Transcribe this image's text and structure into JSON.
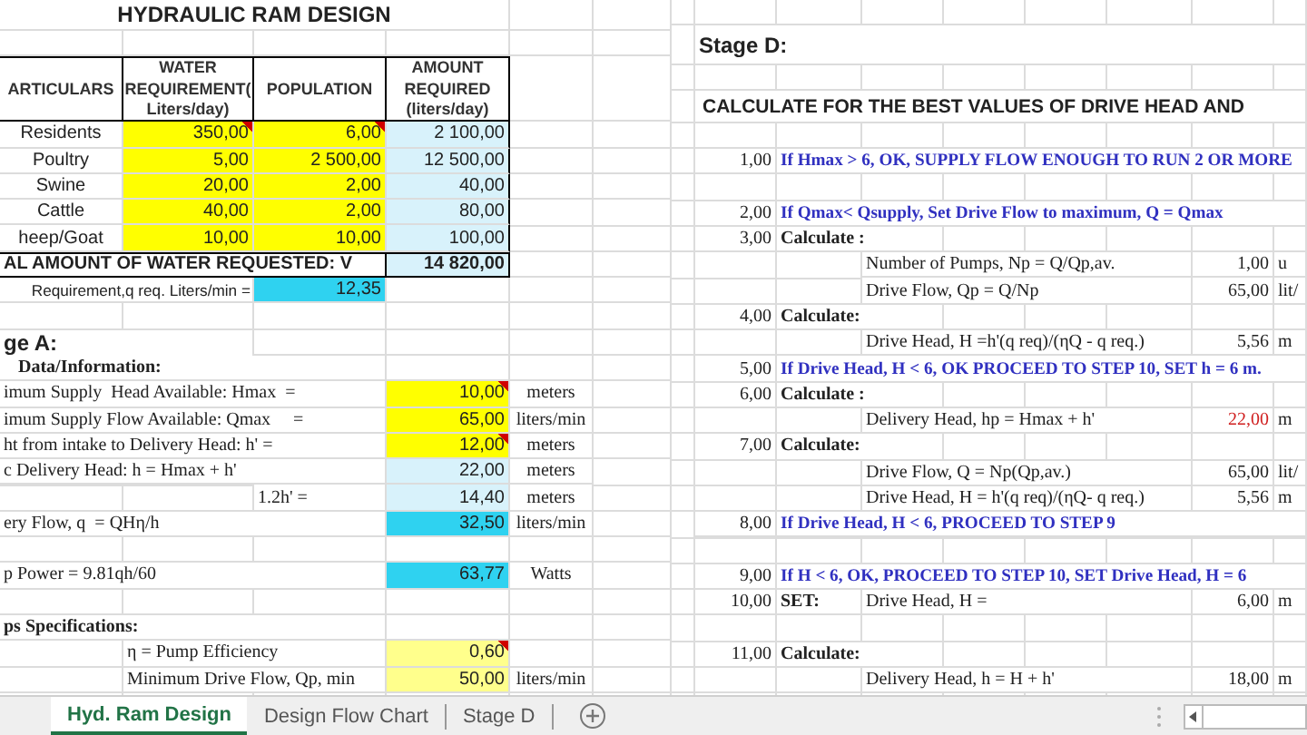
{
  "title": "HYDRAULIC RAM DESIGN",
  "demand_table": {
    "columns": [
      "ARTICULARS",
      "WATER REQUIREMENT( Liters/day)",
      "POPULATION",
      "AMOUNT REQUIRED (liters/day)"
    ],
    "rows": [
      {
        "particular": "Residents",
        "water_requirement": "350,00",
        "water_comment": true,
        "population": "6,00",
        "population_comment": true,
        "amount_required": "2 100,00"
      },
      {
        "particular": "Poultry",
        "water_requirement": "5,00",
        "water_comment": false,
        "population": "2 500,00",
        "population_comment": false,
        "amount_required": "12 500,00"
      },
      {
        "particular": "Swine",
        "water_requirement": "20,00",
        "water_comment": false,
        "population": "2,00",
        "population_comment": false,
        "amount_required": "40,00"
      },
      {
        "particular": "Cattle",
        "water_requirement": "40,00",
        "water_comment": false,
        "population": "2,00",
        "population_comment": false,
        "amount_required": "80,00"
      },
      {
        "particular": "heep/Goat",
        "water_requirement": "10,00",
        "water_comment": false,
        "population": "10,00",
        "population_comment": false,
        "amount_required": "100,00"
      }
    ],
    "total": {
      "label": "AL AMOUNT OF WATER REQUESTED: V",
      "value": "14 820,00"
    }
  },
  "requirement": {
    "label": "Requirement,q req. Liters/min =",
    "value": "12,35"
  },
  "stage_a": {
    "heading": "ge A:",
    "rows": [
      {
        "kind": "subheading",
        "label": "Data/Information:"
      },
      {
        "kind": "field",
        "label": "imum Supply  Head Available: Hmax  =",
        "value": "10,00",
        "unit": "meters",
        "color": "#ffff00",
        "comment": true
      },
      {
        "kind": "field",
        "label": "imum Supply Flow Available: Qmax     =",
        "value": "65,00",
        "unit": "liters/min",
        "color": "#ffff00",
        "comment": false
      },
      {
        "kind": "field",
        "label": "ht from intake to Delivery Head: h' =",
        "value": "12,00",
        "unit": "meters",
        "color": "#ffff00",
        "comment": true
      },
      {
        "kind": "field",
        "label": "c Delivery Head: h = Hmax + h'",
        "value": "22,00",
        "unit": "meters",
        "color": "#d8f2fb",
        "comment": false
      },
      {
        "kind": "aside",
        "label": "1.2h' =",
        "value": "14,40",
        "unit": "meters",
        "color": "#d8f2fb",
        "comment": false
      },
      {
        "kind": "field",
        "label": "ery Flow, q  = QHη/h",
        "value": "32,50",
        "unit": "liters/min",
        "color": "#2fd2f0",
        "comment": false
      },
      {
        "kind": "blank"
      },
      {
        "kind": "field",
        "label": "p Power = 9.81qh/60",
        "value": "63,77",
        "unit": "Watts",
        "color": "#2fd2f0",
        "comment": false
      },
      {
        "kind": "blank"
      },
      {
        "kind": "heading",
        "label": "ps Specifications:"
      },
      {
        "kind": "indented",
        "label": "η = Pump Efficiency",
        "value": "0,60",
        "color": "#ffff8c",
        "comment": true
      },
      {
        "kind": "indented",
        "label": "Minimum Drive Flow, Qp, min",
        "value": "50,00",
        "unit": "liters/min",
        "color": "#ffff8c",
        "comment": false
      }
    ]
  },
  "stage_d": {
    "heading": "Stage D:",
    "title": "CALCULATE FOR THE BEST VALUES OF DRIVE HEAD AND",
    "steps": [
      {
        "kind": "note",
        "step": "1,00",
        "text": "If Hmax > 6, OK, SUPPLY FLOW ENOUGH TO RUN 2 OR MORE"
      },
      {
        "kind": "blank"
      },
      {
        "kind": "note",
        "step": "2,00",
        "text": "If Qmax< Qsupply, Set Drive Flow to maximum, Q = Qmax"
      },
      {
        "kind": "action",
        "step": "3,00",
        "text": "Calculate :"
      },
      {
        "kind": "formula",
        "label": "Number of Pumps, Np = Q/Qp,av.",
        "value": "1,00",
        "unit": "u",
        "flagged": false
      },
      {
        "kind": "formula",
        "label": "Drive Flow, Qp = Q/Np",
        "value": "65,00",
        "unit": "lit/",
        "flagged": false
      },
      {
        "kind": "action",
        "step": "4,00",
        "text": "Calculate:"
      },
      {
        "kind": "formula",
        "label": "Drive Head, H =h'(q req)/(ηQ - q req.)",
        "value": "5,56",
        "unit": "m",
        "flagged": false
      },
      {
        "kind": "note",
        "step": "5,00",
        "text": "If Drive Head, H < 6, OK PROCEED TO STEP 10, SET h = 6 m."
      },
      {
        "kind": "action",
        "step": "6,00",
        "text": "Calculate :"
      },
      {
        "kind": "formula",
        "label": "Delivery Head, hp = Hmax + h'",
        "value": "22,00",
        "unit": "m",
        "flagged": true
      },
      {
        "kind": "action",
        "step": "7,00",
        "text": "Calculate:"
      },
      {
        "kind": "formula",
        "label": "Drive Flow, Q = Np(Qp,av.)",
        "value": "65,00",
        "unit": "lit/",
        "flagged": false
      },
      {
        "kind": "formula",
        "label": "Drive Head, H = h'(q req)/(ηQ- q req.)",
        "value": "5,56",
        "unit": "m",
        "flagged": false
      },
      {
        "kind": "note",
        "step": "8,00",
        "text": "If Drive Head, H < 6, PROCEED TO STEP 9"
      },
      {
        "kind": "blank"
      },
      {
        "kind": "note",
        "step": "9,00",
        "text": "If H < 6, OK, PROCEED TO STEP 10, SET Drive Head, H = 6"
      },
      {
        "kind": "set",
        "step": "10,00",
        "text": "SET:",
        "label": "Drive Head, H =",
        "value": "6,00",
        "unit": "m",
        "flagged": false
      },
      {
        "kind": "blank"
      },
      {
        "kind": "action",
        "step": "11,00",
        "text": "Calculate:"
      },
      {
        "kind": "formula",
        "label": "Delivery Head, h = H + h'",
        "value": "18,00",
        "unit": "m",
        "flagged": false
      }
    ]
  },
  "tabs": [
    {
      "label": "Hyd. Ram Design",
      "selected": true
    },
    {
      "label": "Design Flow Chart",
      "selected": false
    },
    {
      "label": "Stage D",
      "selected": false
    }
  ]
}
